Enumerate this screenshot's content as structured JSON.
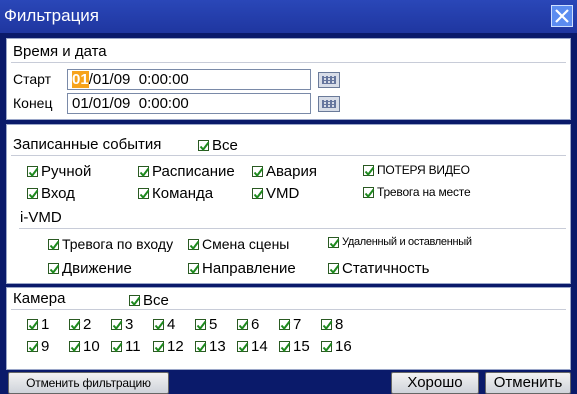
{
  "window": {
    "title": "Фильтрация",
    "close_icon": "close-icon"
  },
  "datetime": {
    "section_title": "Время и дата",
    "start_label": "Старт",
    "start_highlight": "01",
    "start_rest": "/01/09  0:00:00",
    "end_label": "Конец",
    "end_value": "01/01/09  0:00:00"
  },
  "events": {
    "section_title": "Записанные события",
    "all_label": "Все",
    "items": [
      "Ручной",
      "Расписание",
      "Авария",
      "ПОТЕРЯ ВИДЕО",
      "Вход",
      "Команда",
      "VMD",
      "Тревога на месте"
    ],
    "ivmd_title": "i-VMD",
    "ivmd_items": [
      "Тревога по входу",
      "Смена сцены",
      "Удаленный и оставленный",
      "Движение",
      "Направление",
      "Статичность"
    ]
  },
  "camera": {
    "section_title": "Камера",
    "all_label": "Все",
    "items": [
      "1",
      "2",
      "3",
      "4",
      "5",
      "6",
      "7",
      "8",
      "9",
      "10",
      "11",
      "12",
      "13",
      "14",
      "15",
      "16"
    ]
  },
  "buttons": {
    "cancel_filter": "Отменить фильтрацию",
    "ok": "Хорошо",
    "cancel": "Отменить"
  },
  "colors": {
    "title_bar": "#1f36a0",
    "background": "#0a1a6a",
    "cursor_highlight": "#f7a31c",
    "check_mark": "#1e8a1e"
  }
}
